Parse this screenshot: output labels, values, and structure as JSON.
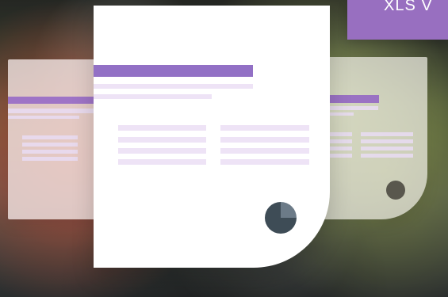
{
  "top_button": {
    "label": "XLS V"
  },
  "colors": {
    "accent": "#986fc0",
    "sheet": "#ffffff",
    "content_bar": "#eee3f6",
    "pie_dark": "#3e4c56",
    "pie_light": "#6c7b88"
  },
  "icons": {
    "pie": "pie-chart-icon",
    "dot": "status-dot-icon"
  }
}
